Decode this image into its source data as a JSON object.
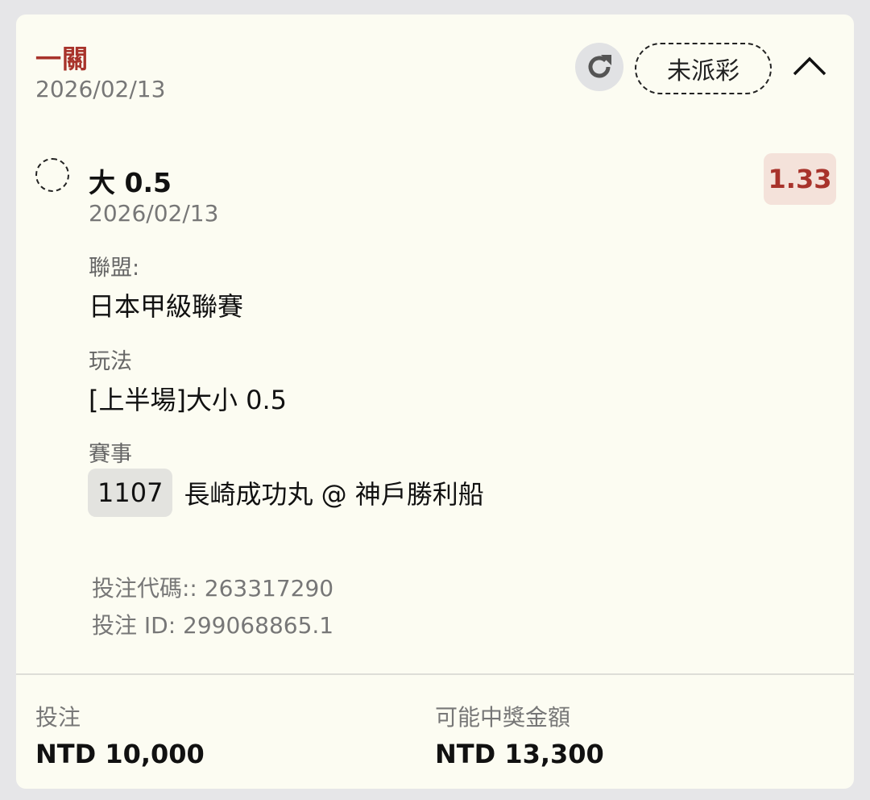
{
  "header": {
    "title": "一關",
    "date": "2026/02/13",
    "status": "未派彩"
  },
  "selection": {
    "name": "大 0.5",
    "date": "2026/02/13",
    "odds": "1.33"
  },
  "details": {
    "league_label": "聯盟:",
    "league_value": "日本甲級聯賽",
    "play_label": "玩法",
    "play_value": "[上半場]大小 0.5",
    "match_label": "賽事",
    "match_number": "1107",
    "match_teams": "長崎成功丸 @ 神戶勝利船"
  },
  "bet_info": {
    "code_line": "投注代碼:: 263317290",
    "id_line": "投注 ID: 299068865.1"
  },
  "footer": {
    "stake_label": "投注",
    "stake_value": "NTD 10,000",
    "payout_label": "可能中獎金額",
    "payout_value": "NTD 13,300"
  },
  "icons": {
    "refresh": "refresh-icon",
    "collapse": "chevron-up-icon",
    "radio": "dashed-circle-icon"
  },
  "colors": {
    "accent": "#a8332b",
    "card_bg": "#fcfcf2",
    "odds_bg": "#f4e2da"
  }
}
